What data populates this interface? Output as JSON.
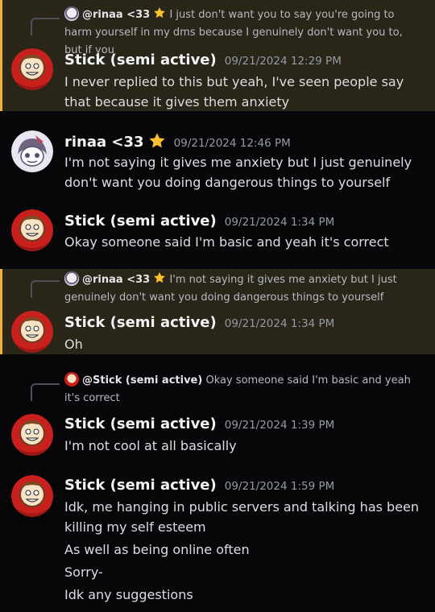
{
  "messages": [
    {
      "reply_to": {
        "author": "@rinaa <33",
        "text": "I just don't want you to say you're going to harm yourself in my dms because I genuinely don't want you to, but if you"
      },
      "author": "Stick (semi active)",
      "timestamp": "09/21/2024 12:29 PM",
      "lines": [
        "I never replied to this but yeah, I've seen people say that because it gives them anxiety"
      ]
    },
    {
      "author": "rinaa <33",
      "timestamp": "09/21/2024 12:46 PM",
      "lines": [
        "I'm not saying it gives me anxiety but I just genuinely don't want you doing dangerous things to yourself"
      ]
    },
    {
      "author": "Stick (semi active)",
      "timestamp": "09/21/2024 1:34 PM",
      "lines": [
        "Okay someone said I'm basic and yeah it's correct"
      ]
    },
    {
      "reply_to": {
        "author": "@rinaa <33",
        "text": "I'm not saying it gives me anxiety but I just genuinely don't want you doing dangerous things to yourself"
      },
      "author": "Stick (semi active)",
      "timestamp": "09/21/2024 1:34 PM",
      "lines": [
        "Oh"
      ]
    },
    {
      "reply_to": {
        "author": "@Stick (semi active)",
        "text": "Okay someone said I'm basic and yeah it's correct"
      },
      "author": "Stick (semi active)",
      "timestamp": "09/21/2024 1:39 PM",
      "lines": [
        "I'm not cool at all basically"
      ]
    },
    {
      "author": "Stick (semi active)",
      "timestamp": "09/21/2024 1:59 PM",
      "lines": [
        "Idk, me hanging in public servers and talking has been killing my self esteem",
        "As well as being online often",
        "Sorry-",
        "Idk any suggestions"
      ]
    }
  ],
  "icons": {
    "star": "star-icon"
  },
  "colors": {
    "highlight_bg": "#2a2519",
    "highlight_bar": "#efb132",
    "background": "#070709"
  }
}
